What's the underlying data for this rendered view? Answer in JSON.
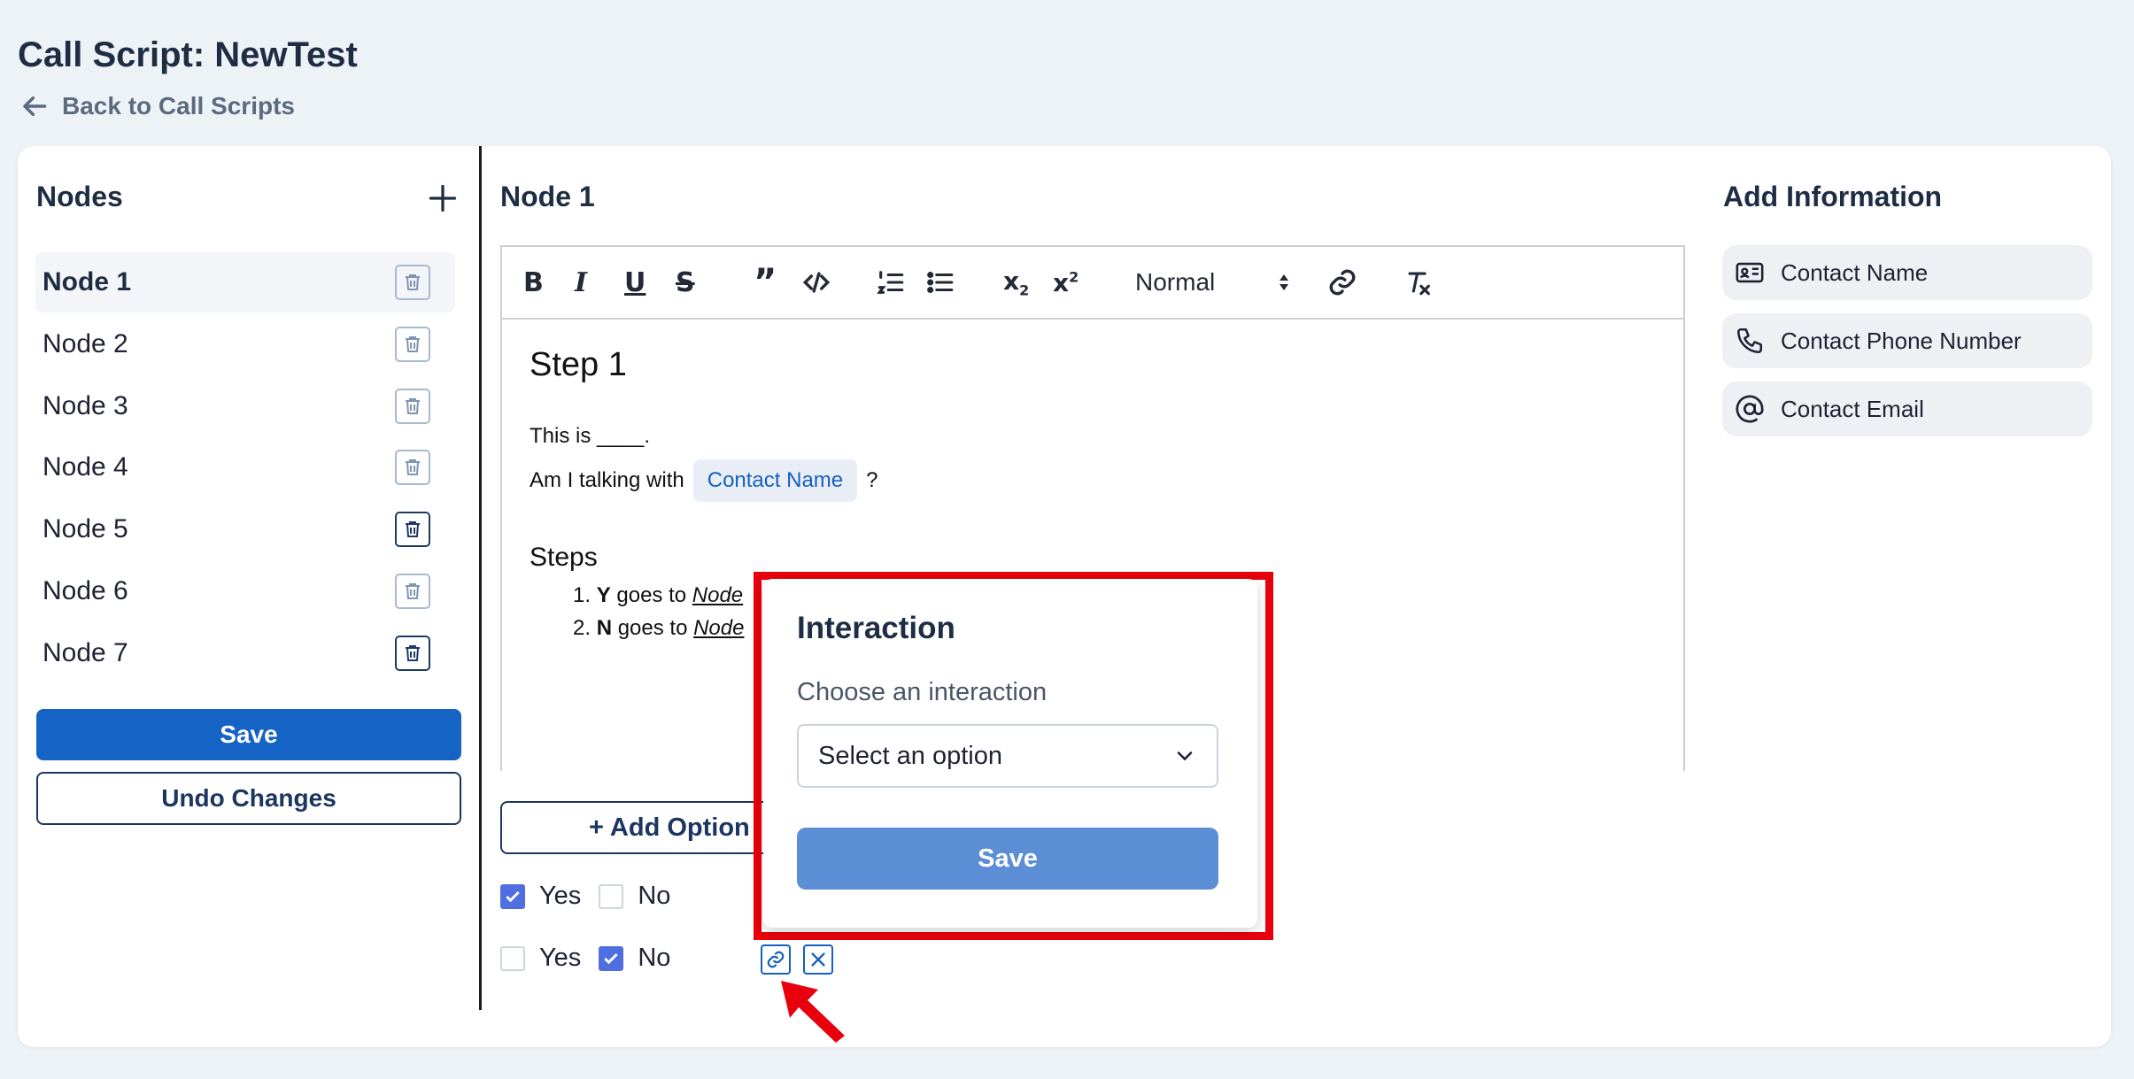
{
  "header": {
    "title": "Call Script: NewTest",
    "back_label": "Back to Call Scripts"
  },
  "sidebar": {
    "title": "Nodes",
    "items": [
      {
        "label": "Node 1",
        "active": true
      },
      {
        "label": "Node 2"
      },
      {
        "label": "Node 3"
      },
      {
        "label": "Node 4"
      },
      {
        "label": "Node 5"
      },
      {
        "label": "Node 6"
      },
      {
        "label": "Node 7"
      }
    ],
    "save_label": "Save",
    "undo_label": "Undo Changes"
  },
  "editor": {
    "node_title": "Node 1",
    "format_value": "Normal",
    "content": {
      "step_title": "Step 1",
      "line1": "This is ____.",
      "line2_prefix": "Am I talking with",
      "line2_chip": "Contact Name",
      "line2_suffix": "?",
      "steps_heading": "Steps",
      "steps": [
        {
          "num": "1.",
          "key": "Y",
          "text": " goes to ",
          "link": "Node"
        },
        {
          "num": "2.",
          "key": "N",
          "text": " goes to ",
          "link": "Node"
        }
      ]
    },
    "add_option_label": "+ Add Option",
    "options": [
      {
        "yes_label": "Yes",
        "no_label": "No",
        "yes_checked": true,
        "no_checked": false
      },
      {
        "yes_label": "Yes",
        "no_label": "No",
        "yes_checked": false,
        "no_checked": true
      }
    ]
  },
  "add_information": {
    "title": "Add Information",
    "items": [
      {
        "label": "Contact Name",
        "icon": "id-card-icon"
      },
      {
        "label": "Contact Phone Number",
        "icon": "phone-icon"
      },
      {
        "label": "Contact Email",
        "icon": "at-sign-icon"
      }
    ]
  },
  "interaction_popup": {
    "title": "Interaction",
    "label": "Choose an interaction",
    "select_placeholder": "Select an option",
    "save_label": "Save"
  },
  "colors": {
    "primary": "#1563c4",
    "popup_save": "#5b8ed4",
    "highlight_outline": "#e8000c",
    "checkbox": "#4f6fe0"
  }
}
